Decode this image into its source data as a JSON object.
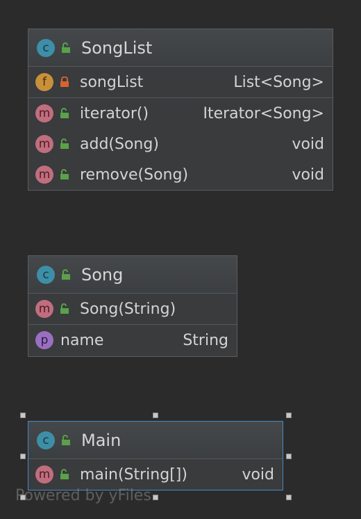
{
  "classes": {
    "songlist": {
      "name": "SongList",
      "field": {
        "name": "songList",
        "type": "List<Song>"
      },
      "methods": [
        {
          "name": "iterator()",
          "type": "Iterator<Song>"
        },
        {
          "name": "add(Song)",
          "type": "void"
        },
        {
          "name": "remove(Song)",
          "type": "void"
        }
      ]
    },
    "song": {
      "name": "Song",
      "constructor": {
        "name": "Song(String)"
      },
      "property": {
        "name": "name",
        "type": "String"
      }
    },
    "main": {
      "name": "Main",
      "method": {
        "name": "main(String[])",
        "type": "void"
      }
    }
  },
  "icons": {
    "class": "c",
    "method": "m",
    "field": "f",
    "property": "p"
  },
  "watermark": "Powered by yFiles",
  "colors": {
    "background": "#2b2b2b",
    "node": "#393b3d",
    "selection": "#4a88c7",
    "public_lock": "#5aa14a",
    "private_lock": "#d9632f"
  }
}
